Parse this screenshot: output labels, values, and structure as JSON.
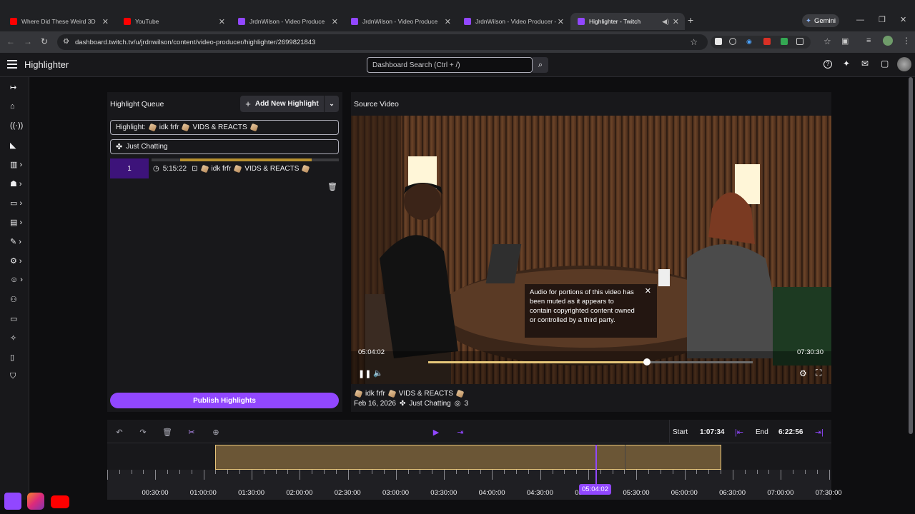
{
  "browser": {
    "tabs": [
      {
        "title": "Where Did These Weird 3D",
        "color": "#ff0000"
      },
      {
        "title": "YouTube",
        "color": "#ff0000"
      },
      {
        "title": "JrdnWilson - Video Produce",
        "color": "#9147ff"
      },
      {
        "title": "JrdnWilson - Video Produce",
        "color": "#9147ff"
      },
      {
        "title": "JrdnWilson - Video Producer -",
        "color": "#9147ff"
      },
      {
        "title": "Highlighter - Twitch",
        "color": "#9147ff"
      }
    ],
    "url": "dashboard.twitch.tv/u/jrdnwilson/content/video-producer/highlighter/2699821843",
    "gemini_label": "Gemini"
  },
  "app": {
    "title": "Highlighter",
    "search_placeholder": "Dashboard Search (Ctrl + /)"
  },
  "queue": {
    "header": "Highlight Queue",
    "add_label": "Add New Highlight",
    "title_prefix": "Highlight:",
    "title_text": "idk frfr",
    "title_tag": "VIDS & REACTS",
    "category": "Just Chatting",
    "item": {
      "index": "1",
      "duration": "5:15:22",
      "name": "idk frfr",
      "tag": "VIDS & REACTS"
    },
    "publish_label": "Publish Highlights"
  },
  "source": {
    "header": "Source Video",
    "time_current": "05:04:02",
    "time_total": "07:30:30",
    "progress": 0.674,
    "notice": "Audio for portions of this video has been muted as it appears to contain copyrighted content owned or controlled by a third party.",
    "meta_title": "idk frfr",
    "meta_tag": "VIDS & REACTS",
    "meta_date": "Feb 16, 2026",
    "meta_category": "Just Chatting",
    "meta_views": "3"
  },
  "timeline": {
    "start_label": "Start",
    "start_value": "1:07:34",
    "end_label": "End",
    "end_value": "6:22:56",
    "playhead": "05:04:02",
    "ticks": [
      "00:30:00",
      "01:00:00",
      "01:30:00",
      "02:00:00",
      "02:30:00",
      "03:00:00",
      "03:30:00",
      "04:00:00",
      "04:30:00",
      "05:00:00",
      "05:30:00",
      "06:00:00",
      "06:30:00",
      "07:00:00",
      "07:30:00"
    ]
  }
}
